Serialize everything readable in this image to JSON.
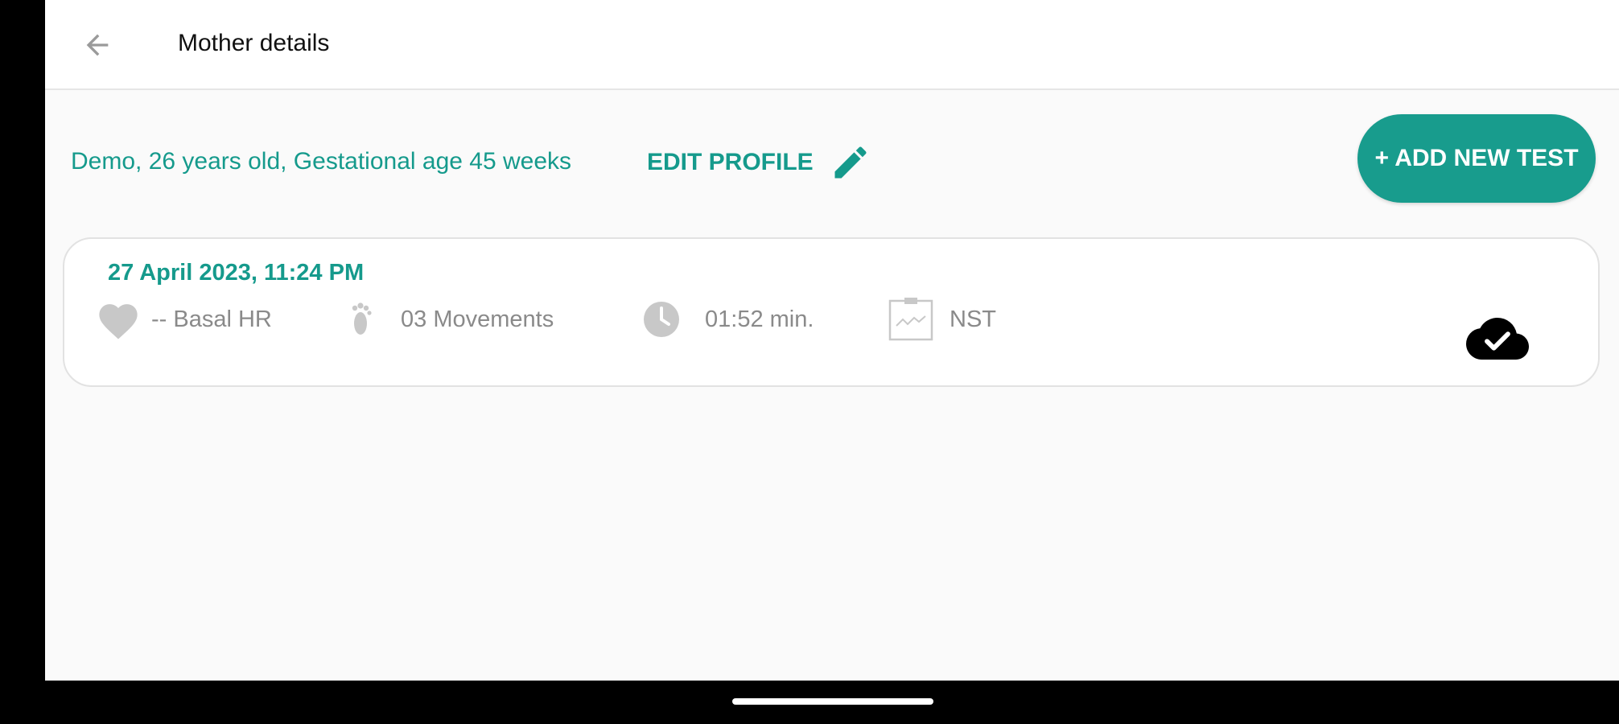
{
  "header": {
    "title": "Mother details",
    "back_icon": "arrow-back-icon"
  },
  "profile": {
    "info": "Demo,  26 years old, Gestational age  45 weeks",
    "edit_label": "EDIT PROFILE",
    "edit_icon": "pencil-icon"
  },
  "actions": {
    "add_test_label": "+ ADD NEW TEST"
  },
  "tests": [
    {
      "date": "27 April 2023, 11:24 PM",
      "basal_hr": "-- Basal HR",
      "movements": "03 Movements",
      "duration": "01:52 min.",
      "type": "NST",
      "sync_status": "synced"
    }
  ],
  "colors": {
    "accent": "#159a8c",
    "button": "#189c8d",
    "muted_text": "#8a8a8a",
    "icon_gray": "#c8c8c8",
    "background": "#fafafa"
  }
}
